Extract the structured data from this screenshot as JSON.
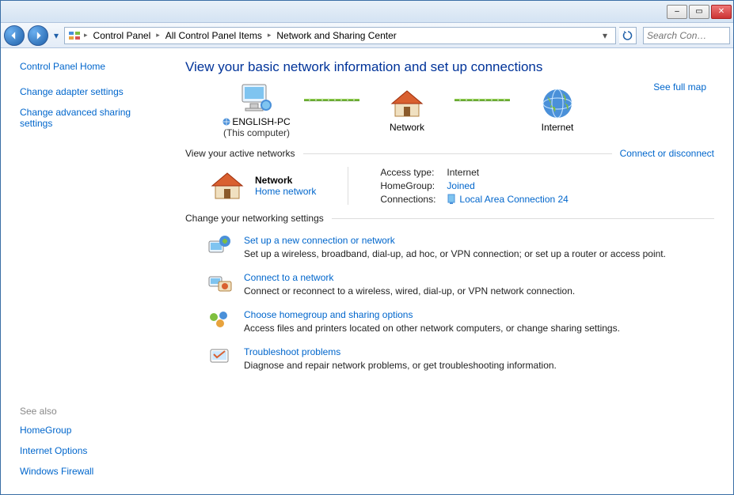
{
  "titlebar": {
    "min": "–",
    "max": "▭",
    "close": "✕"
  },
  "nav": {
    "breadcrumbs": [
      "Control Panel",
      "All Control Panel Items",
      "Network and Sharing Center"
    ],
    "search_placeholder": "Search Con…"
  },
  "sidebar": {
    "home": "Control Panel Home",
    "links": [
      "Change adapter settings",
      "Change advanced sharing settings"
    ],
    "see_also_hdr": "See also",
    "see_also": [
      "HomeGroup",
      "Internet Options",
      "Windows Firewall"
    ]
  },
  "main": {
    "title": "View your basic network information and set up connections",
    "map": {
      "pc_name": "ENGLISH-PC",
      "pc_sub": "(This computer)",
      "network_label": "Network",
      "internet_label": "Internet",
      "see_full_map": "See full map"
    },
    "active_hdr": "View your active networks",
    "connect_disconnect": "Connect or disconnect",
    "active": {
      "name": "Network",
      "type": "Home network",
      "access_k": "Access type:",
      "access_v": "Internet",
      "hg_k": "HomeGroup:",
      "hg_v": "Joined",
      "conn_k": "Connections:",
      "conn_v": "Local Area Connection 24"
    },
    "change_hdr": "Change your networking settings",
    "tasks": [
      {
        "title": "Set up a new connection or network",
        "desc": "Set up a wireless, broadband, dial-up, ad hoc, or VPN connection; or set up a router or access point."
      },
      {
        "title": "Connect to a network",
        "desc": "Connect or reconnect to a wireless, wired, dial-up, or VPN network connection."
      },
      {
        "title": "Choose homegroup and sharing options",
        "desc": "Access files and printers located on other network computers, or change sharing settings."
      },
      {
        "title": "Troubleshoot problems",
        "desc": "Diagnose and repair network problems, or get troubleshooting information."
      }
    ]
  }
}
